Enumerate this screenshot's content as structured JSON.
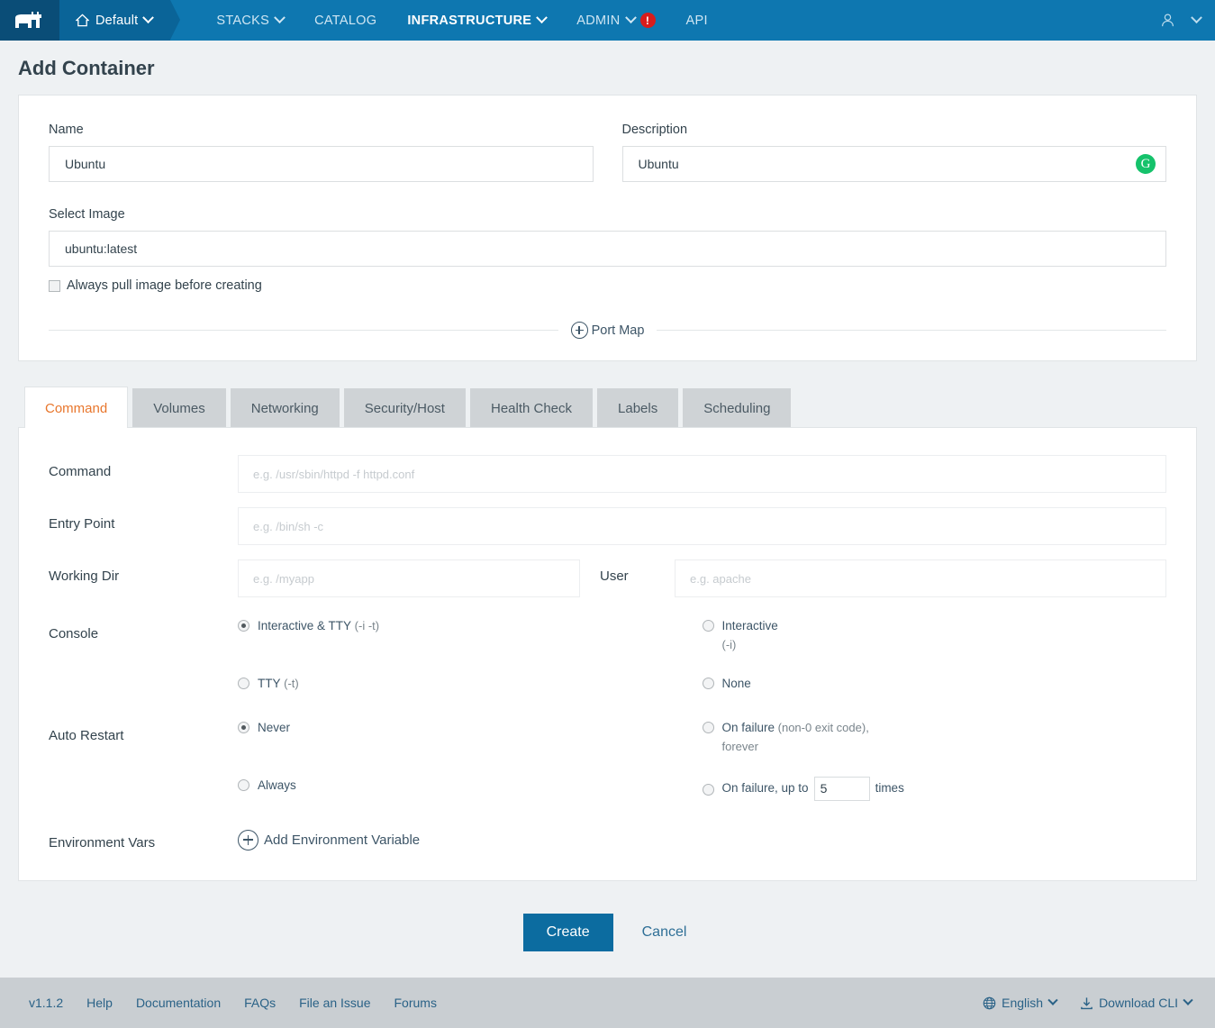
{
  "nav": {
    "logo": "rancher-cow-logo",
    "env": {
      "label": "Default",
      "icon": "home-icon"
    },
    "items": [
      {
        "label": "STACKS",
        "has_caret": true,
        "active": false
      },
      {
        "label": "CATALOG",
        "has_caret": false,
        "active": false
      },
      {
        "label": "INFRASTRUCTURE",
        "has_caret": true,
        "active": true
      },
      {
        "label": "ADMIN",
        "has_caret": true,
        "active": false,
        "badge": "!"
      },
      {
        "label": "API",
        "has_caret": false,
        "active": false
      }
    ],
    "user_icon": "user-icon"
  },
  "header": {
    "title": "Add Container"
  },
  "form": {
    "name": {
      "label": "Name",
      "value": "Ubuntu",
      "placeholder": ""
    },
    "description": {
      "label": "Description",
      "value": "Ubuntu",
      "placeholder": "",
      "badge_icon": "grammarly-icon",
      "badge_letter": "G"
    },
    "select_image": {
      "label": "Select Image",
      "value": "ubuntu:latest",
      "placeholder": ""
    },
    "always_pull": {
      "label": "Always pull image before creating",
      "checked": false
    },
    "port_map": {
      "label": "Port Map"
    }
  },
  "tabs": [
    {
      "label": "Command",
      "active": true
    },
    {
      "label": "Volumes",
      "active": false
    },
    {
      "label": "Networking",
      "active": false
    },
    {
      "label": "Security/Host",
      "active": false
    },
    {
      "label": "Health Check",
      "active": false
    },
    {
      "label": "Labels",
      "active": false
    },
    {
      "label": "Scheduling",
      "active": false
    }
  ],
  "command_tab": {
    "command": {
      "label": "Command",
      "value": "",
      "placeholder": "e.g. /usr/sbin/httpd -f httpd.conf"
    },
    "entry_point": {
      "label": "Entry Point",
      "value": "",
      "placeholder": "e.g. /bin/sh -c"
    },
    "working_dir": {
      "label": "Working Dir",
      "value": "",
      "placeholder": "e.g. /myapp"
    },
    "user": {
      "label": "User",
      "value": "",
      "placeholder": "e.g. apache"
    },
    "console": {
      "label": "Console",
      "options": [
        {
          "text": "Interactive & TTY",
          "muted": " (-i -t)",
          "checked": true
        },
        {
          "text": "Interactive",
          "muted": " (-i)",
          "checked": false
        },
        {
          "text": "TTY",
          "muted": " (-t)",
          "checked": false
        },
        {
          "text": "None",
          "muted": "",
          "checked": false
        }
      ]
    },
    "auto_restart": {
      "label": "Auto Restart",
      "options": [
        {
          "text": "Never",
          "muted": "",
          "checked": true
        },
        {
          "text": "On failure",
          "muted": " (non-0 exit code), forever",
          "checked": false
        },
        {
          "text": "Always",
          "muted": "",
          "checked": false
        },
        {
          "text": "On failure, up to",
          "muted": "",
          "checked": false,
          "count": "5",
          "suffix": "times"
        }
      ]
    },
    "environment_vars": {
      "label": "Environment Vars",
      "add_label": "Add Environment Variable"
    }
  },
  "actions": {
    "create": "Create",
    "cancel": "Cancel"
  },
  "footer": {
    "version": "v1.1.2",
    "links": [
      "Help",
      "Documentation",
      "FAQs",
      "File an Issue",
      "Forums"
    ],
    "language": {
      "label": "English",
      "icon": "globe-icon"
    },
    "download": {
      "label": "Download CLI",
      "icon": "download-icon"
    }
  },
  "colors": {
    "nav_bg": "#0e77b0",
    "nav_logo_bg": "#0a4d77",
    "nav_env_bg": "#0a6498",
    "accent_orange": "#e8762c",
    "primary_button": "#0c6ca0",
    "alert_red": "#d81c1c",
    "grammarly_green": "#15c26b",
    "footer_bg": "#c9ced2",
    "page_bg": "#eef1f3"
  }
}
